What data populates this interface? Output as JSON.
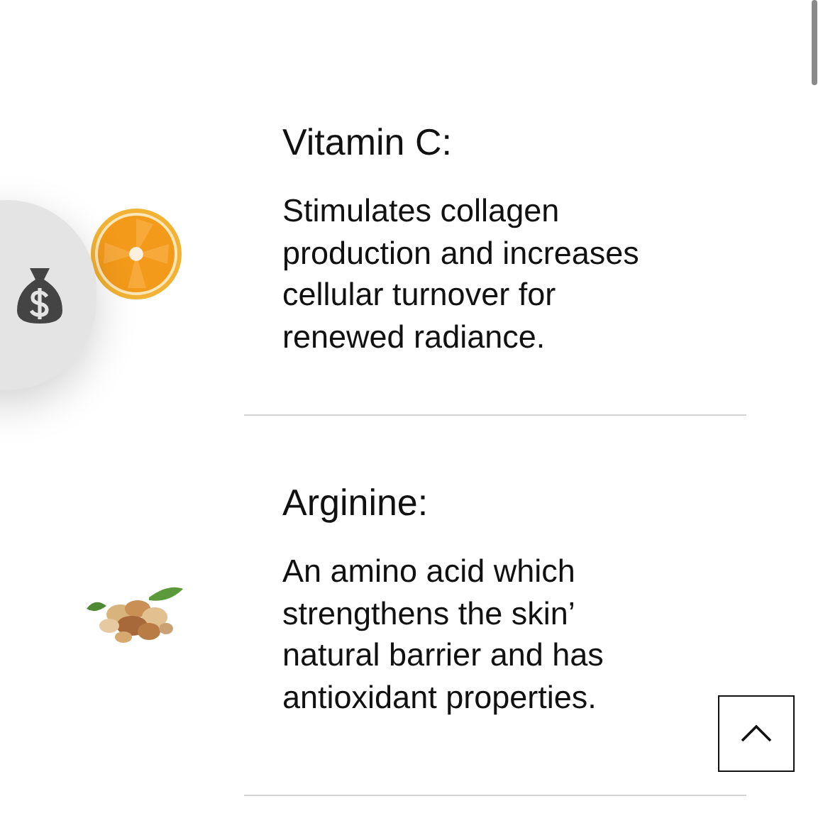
{
  "sections": [
    {
      "heading": "Vitamin C:",
      "body": "Stimulates collagen production and increases cellular turnover for renewed radiance."
    },
    {
      "heading": "Arginine:",
      "body": "An amino acid which strengthens the skin’ natural barrier and has antioxidant properties."
    }
  ]
}
